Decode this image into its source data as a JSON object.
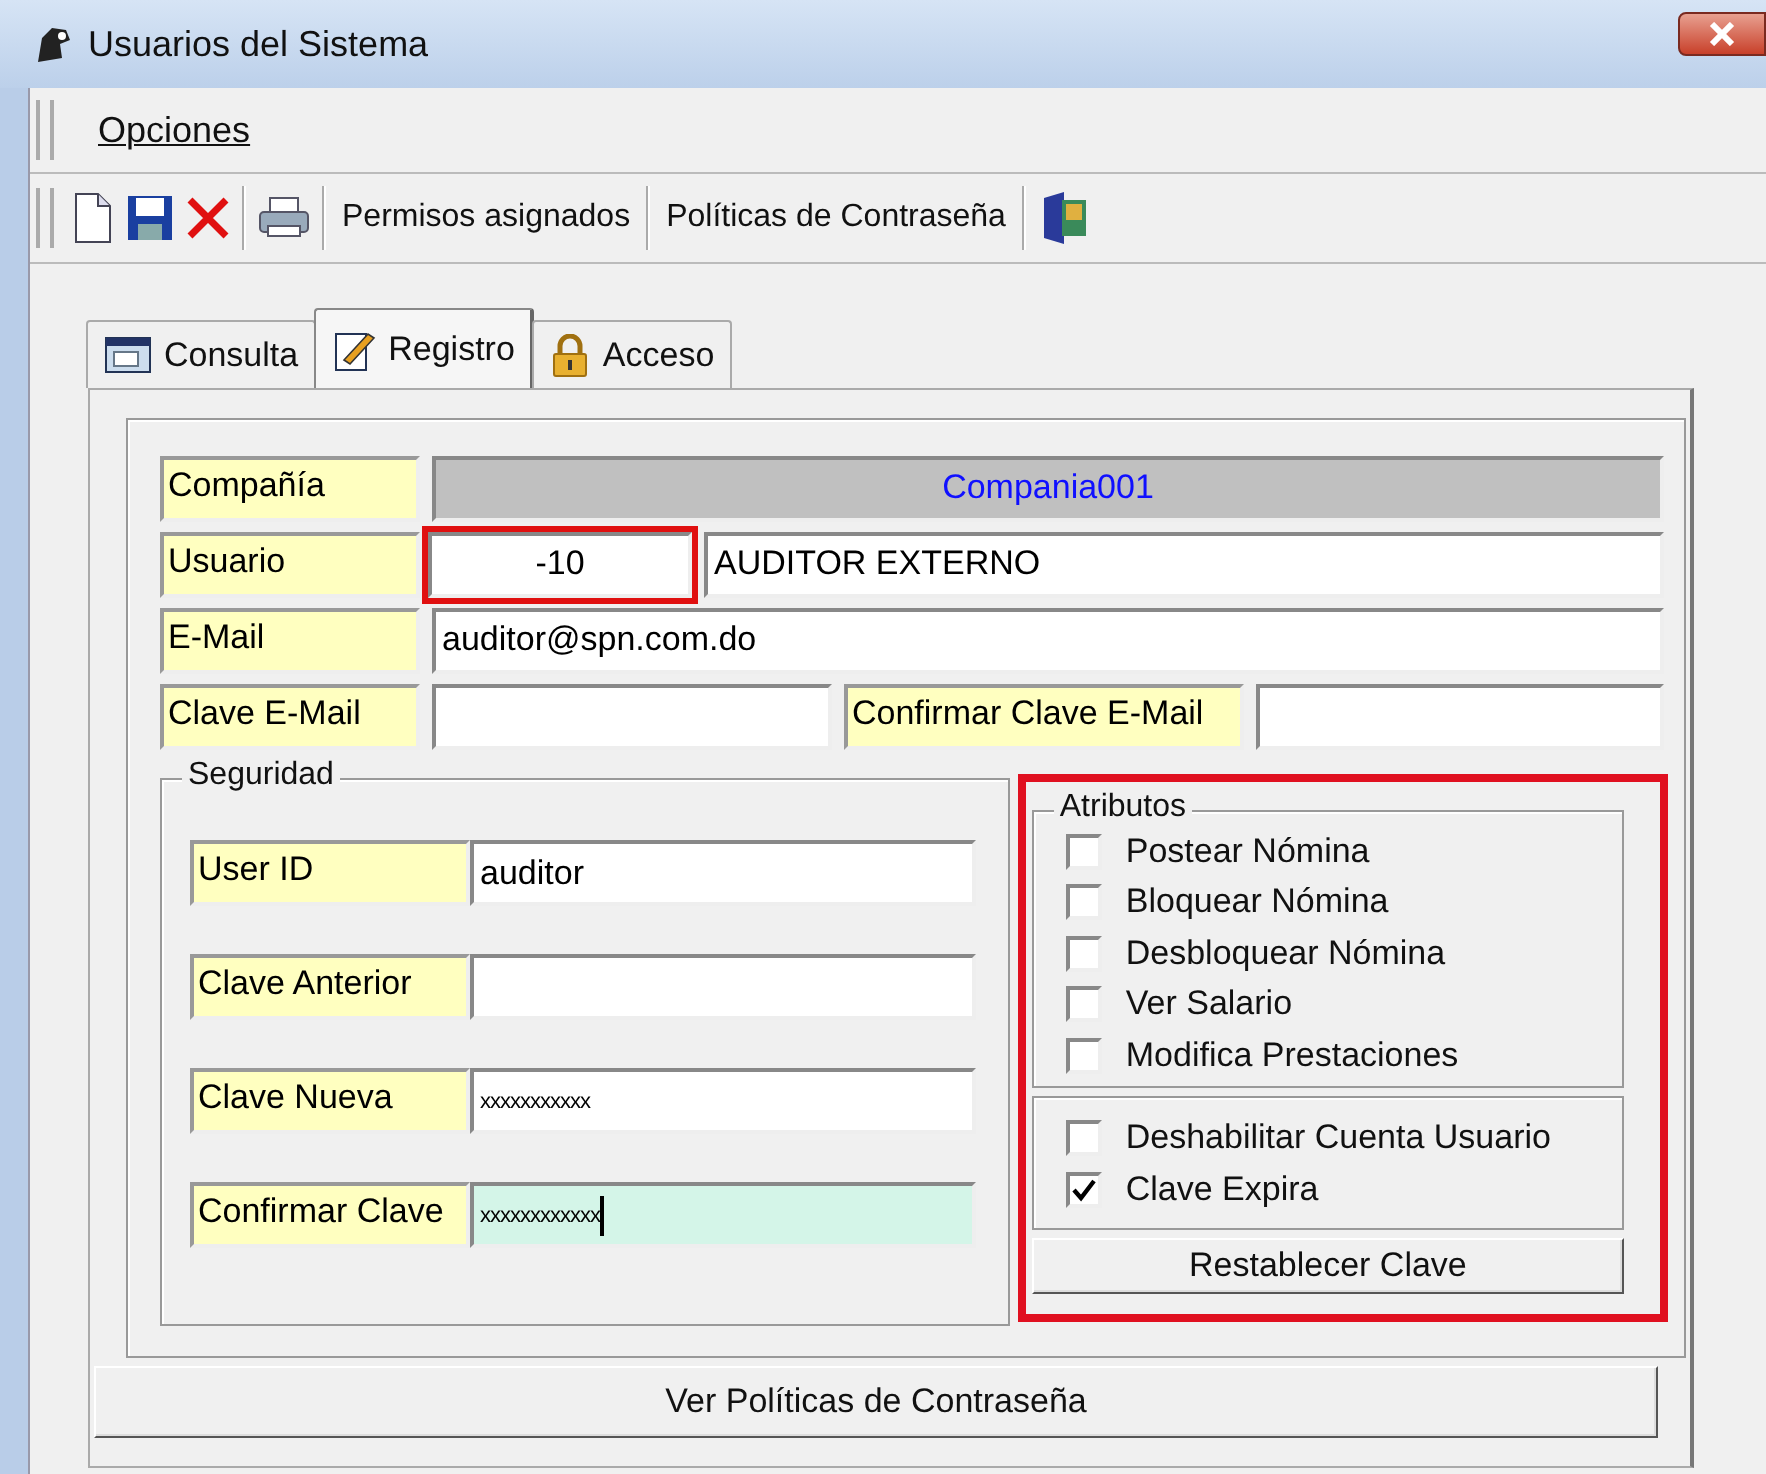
{
  "window": {
    "title": "Usuarios del Sistema"
  },
  "menu": [
    {
      "label": "Opciones"
    }
  ],
  "toolbar": {
    "buttons": [
      "Permisos asignados",
      "Políticas de Contraseña"
    ]
  },
  "tabs": [
    {
      "label": "Consulta",
      "selected": false
    },
    {
      "label": "Registro",
      "selected": true
    },
    {
      "label": "Acceso",
      "selected": false
    }
  ],
  "company": {
    "label": "Compañía",
    "value": "Compania001"
  },
  "user": {
    "label": "Usuario",
    "code": "-10",
    "name": "AUDITOR EXTERNO",
    "highlighted": true
  },
  "email": {
    "label": "E-Mail",
    "value": "auditor@spn.com.do"
  },
  "email_password": {
    "label": "Clave E-Mail",
    "confirm_label": "Confirmar Clave E-Mail"
  },
  "security": {
    "title": "Seguridad",
    "fields": [
      {
        "kind": "text",
        "label": "User ID",
        "value": "auditor",
        "focused": false
      },
      {
        "kind": "password",
        "label": "Clave Anterior",
        "focused": false
      },
      {
        "kind": "password",
        "label": "Clave Nueva",
        "value": "xxxxxxxxxxx",
        "focused": false
      },
      {
        "kind": "password",
        "label": "Confirmar Clave",
        "value": "xxxxxxxxxxxx",
        "focused": true
      }
    ]
  },
  "attributes": {
    "title": "Atributos",
    "highlighted": true,
    "permissions": [
      {
        "label": "Postear Nómina",
        "checked": false
      },
      {
        "label": "Bloquear Nómina",
        "checked": false
      },
      {
        "label": "Desbloquear Nómina",
        "checked": false
      },
      {
        "label": "Ver Salario",
        "checked": false
      },
      {
        "label": "Modifica Prestaciones",
        "checked": false
      }
    ],
    "account": [
      {
        "label": "Deshabilitar Cuenta Usuario",
        "checked": false
      },
      {
        "label": "Clave Expira",
        "checked": true
      }
    ],
    "button": "Restablecer Clave"
  },
  "footer_button": "Ver Políticas de Contraseña"
}
